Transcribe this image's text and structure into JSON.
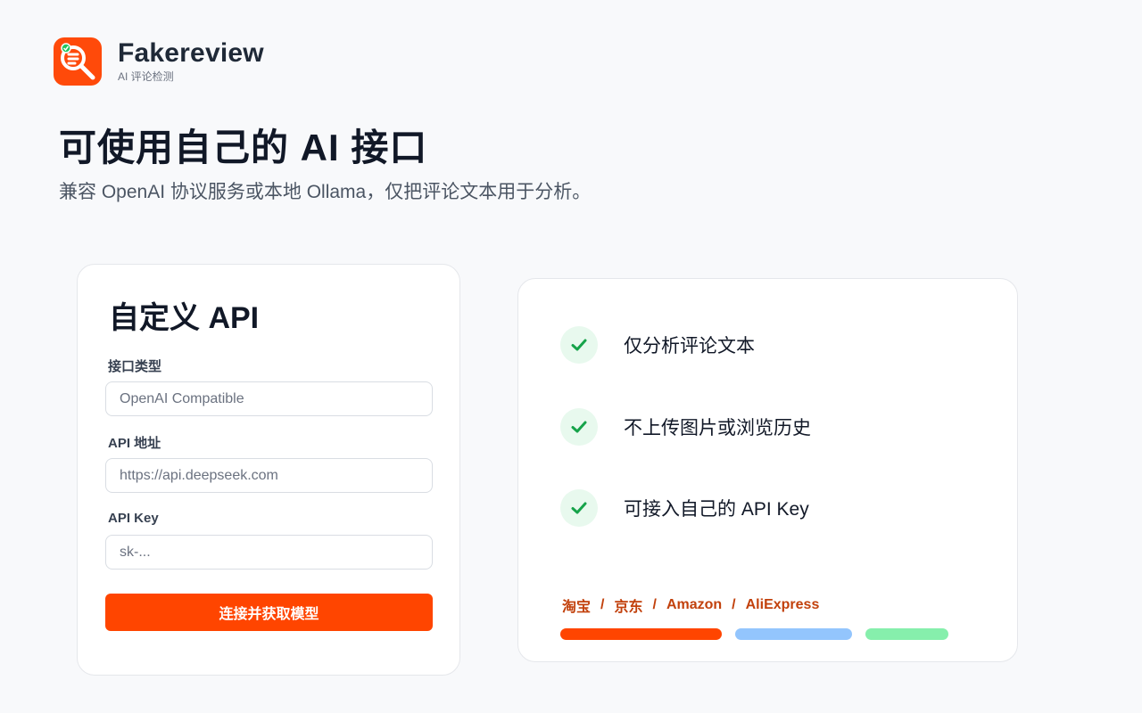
{
  "brand": {
    "name": "Fakereview",
    "subtitle": "AI 评论检测",
    "logo_icon": "magnifier-list-icon",
    "accent_color": "#ff4a0a"
  },
  "hero": {
    "title": "可使用自己的 AI 接口",
    "subtitle": "兼容 OpenAI 协议服务或本地 Ollama，仅把评论文本用于分析。"
  },
  "form": {
    "title": "自定义 API",
    "fields": [
      {
        "label": "接口类型",
        "placeholder": "OpenAI Compatible",
        "value": ""
      },
      {
        "label": "API 地址",
        "placeholder": "https://api.deepseek.com",
        "value": ""
      },
      {
        "label": "API Key",
        "placeholder": "sk-...",
        "value": ""
      }
    ],
    "submit_label": "连接并获取模型",
    "submit_color": "#ff4500"
  },
  "features": {
    "items": [
      {
        "icon": "check-icon",
        "text": "仅分析评论文本"
      },
      {
        "icon": "check-icon",
        "text": "不上传图片或浏览历史"
      },
      {
        "icon": "check-icon",
        "text": "可接入自己的 API Key"
      }
    ],
    "platforms": [
      "淘宝",
      "京东",
      "Amazon",
      "AliExpress"
    ],
    "separator": "/",
    "bar_colors": [
      "#ff4500",
      "#93c5fd",
      "#86efac"
    ]
  }
}
